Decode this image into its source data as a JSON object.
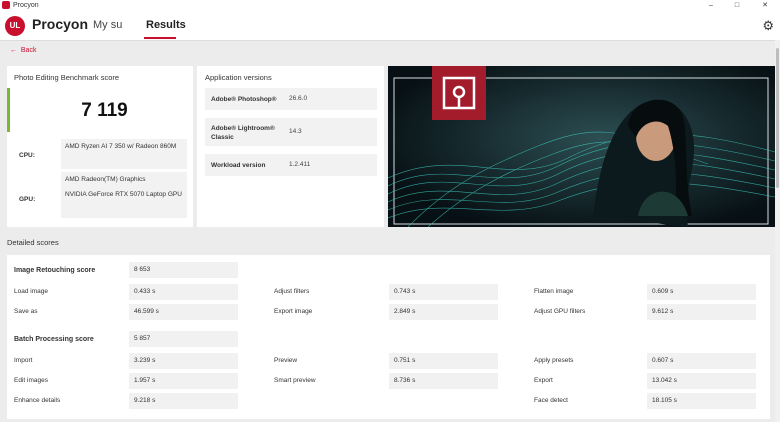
{
  "window": {
    "title": "Procyon",
    "minimize": "–",
    "maximize": "□",
    "close": "✕"
  },
  "header": {
    "app_name": "Procyon",
    "tabs": [
      {
        "label": "My su"
      },
      {
        "label": "Results"
      }
    ],
    "logo_text": "UL",
    "settings_icon": "gear-icon"
  },
  "back_label": "Back",
  "score_card": {
    "title": "Photo Editing Benchmark score",
    "score": "7 119",
    "cpu_label": "CPU:",
    "cpu_value": "AMD Ryzen AI 7 350 w/ Radeon 860M",
    "gpu_label": "GPU:",
    "gpu_value_1": "AMD Radeon(TM) Graphics",
    "gpu_value_2": "NVIDIA GeForce RTX 5070 Laptop GPU"
  },
  "versions_card": {
    "title": "Application versions",
    "items": [
      {
        "name": "Adobe® Photoshop®",
        "value": "26.6.0"
      },
      {
        "name": "Adobe® Lightroom® Classic",
        "value": "14.3"
      },
      {
        "name": "Workload version",
        "value": "1.2.411"
      }
    ]
  },
  "detailed_title": "Detailed scores",
  "retouching": {
    "title": "Image Retouching score",
    "score": "8 653",
    "rows": [
      [
        {
          "label": "Load image",
          "value": "0.433 s"
        },
        {
          "label": "Adjust filters",
          "value": "0.743 s"
        },
        {
          "label": "Flatten image",
          "value": "0.609 s"
        }
      ],
      [
        {
          "label": "Save as",
          "value": "46.599 s"
        },
        {
          "label": "Export image",
          "value": "2.849 s"
        },
        {
          "label": "Adjust GPU filters",
          "value": "9.612 s"
        }
      ]
    ]
  },
  "batch": {
    "title": "Batch Processing score",
    "score": "5 857",
    "rows": [
      [
        {
          "label": "Import",
          "value": "3.239 s"
        },
        {
          "label": "Preview",
          "value": "0.751 s"
        },
        {
          "label": "Apply presets",
          "value": "0.607 s"
        }
      ],
      [
        {
          "label": "Edit images",
          "value": "1.957 s"
        },
        {
          "label": "Smart preview",
          "value": "8.736 s"
        },
        {
          "label": "Export",
          "value": "13.042 s"
        }
      ],
      [
        {
          "label": "Enhance details",
          "value": "9.218 s"
        },
        {
          "label": "Face detect",
          "value": "18.105 s"
        }
      ]
    ]
  },
  "colors": {
    "accent": "#c8102e",
    "score_bar": "#7ab833",
    "background": "#ececec"
  }
}
